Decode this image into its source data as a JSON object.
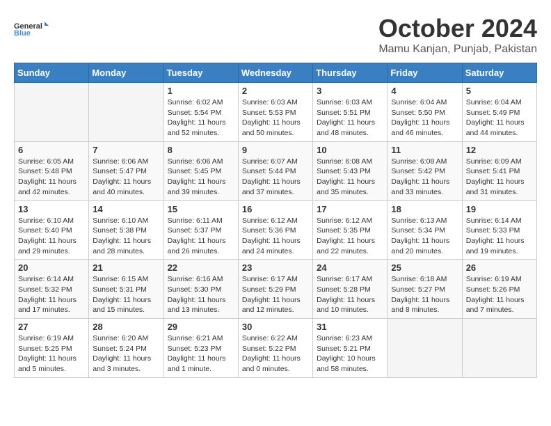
{
  "header": {
    "logo_general": "General",
    "logo_blue": "Blue",
    "month": "October 2024",
    "location": "Mamu Kanjan, Punjab, Pakistan"
  },
  "days_of_week": [
    "Sunday",
    "Monday",
    "Tuesday",
    "Wednesday",
    "Thursday",
    "Friday",
    "Saturday"
  ],
  "weeks": [
    [
      {
        "day": "",
        "empty": true
      },
      {
        "day": "",
        "empty": true
      },
      {
        "day": "1",
        "sunrise": "6:02 AM",
        "sunset": "5:54 PM",
        "daylight": "11 hours and 52 minutes."
      },
      {
        "day": "2",
        "sunrise": "6:03 AM",
        "sunset": "5:53 PM",
        "daylight": "11 hours and 50 minutes."
      },
      {
        "day": "3",
        "sunrise": "6:03 AM",
        "sunset": "5:51 PM",
        "daylight": "11 hours and 48 minutes."
      },
      {
        "day": "4",
        "sunrise": "6:04 AM",
        "sunset": "5:50 PM",
        "daylight": "11 hours and 46 minutes."
      },
      {
        "day": "5",
        "sunrise": "6:04 AM",
        "sunset": "5:49 PM",
        "daylight": "11 hours and 44 minutes."
      }
    ],
    [
      {
        "day": "6",
        "sunrise": "6:05 AM",
        "sunset": "5:48 PM",
        "daylight": "11 hours and 42 minutes."
      },
      {
        "day": "7",
        "sunrise": "6:06 AM",
        "sunset": "5:47 PM",
        "daylight": "11 hours and 40 minutes."
      },
      {
        "day": "8",
        "sunrise": "6:06 AM",
        "sunset": "5:45 PM",
        "daylight": "11 hours and 39 minutes."
      },
      {
        "day": "9",
        "sunrise": "6:07 AM",
        "sunset": "5:44 PM",
        "daylight": "11 hours and 37 minutes."
      },
      {
        "day": "10",
        "sunrise": "6:08 AM",
        "sunset": "5:43 PM",
        "daylight": "11 hours and 35 minutes."
      },
      {
        "day": "11",
        "sunrise": "6:08 AM",
        "sunset": "5:42 PM",
        "daylight": "11 hours and 33 minutes."
      },
      {
        "day": "12",
        "sunrise": "6:09 AM",
        "sunset": "5:41 PM",
        "daylight": "11 hours and 31 minutes."
      }
    ],
    [
      {
        "day": "13",
        "sunrise": "6:10 AM",
        "sunset": "5:40 PM",
        "daylight": "11 hours and 29 minutes."
      },
      {
        "day": "14",
        "sunrise": "6:10 AM",
        "sunset": "5:38 PM",
        "daylight": "11 hours and 28 minutes."
      },
      {
        "day": "15",
        "sunrise": "6:11 AM",
        "sunset": "5:37 PM",
        "daylight": "11 hours and 26 minutes."
      },
      {
        "day": "16",
        "sunrise": "6:12 AM",
        "sunset": "5:36 PM",
        "daylight": "11 hours and 24 minutes."
      },
      {
        "day": "17",
        "sunrise": "6:12 AM",
        "sunset": "5:35 PM",
        "daylight": "11 hours and 22 minutes."
      },
      {
        "day": "18",
        "sunrise": "6:13 AM",
        "sunset": "5:34 PM",
        "daylight": "11 hours and 20 minutes."
      },
      {
        "day": "19",
        "sunrise": "6:14 AM",
        "sunset": "5:33 PM",
        "daylight": "11 hours and 19 minutes."
      }
    ],
    [
      {
        "day": "20",
        "sunrise": "6:14 AM",
        "sunset": "5:32 PM",
        "daylight": "11 hours and 17 minutes."
      },
      {
        "day": "21",
        "sunrise": "6:15 AM",
        "sunset": "5:31 PM",
        "daylight": "11 hours and 15 minutes."
      },
      {
        "day": "22",
        "sunrise": "6:16 AM",
        "sunset": "5:30 PM",
        "daylight": "11 hours and 13 minutes."
      },
      {
        "day": "23",
        "sunrise": "6:17 AM",
        "sunset": "5:29 PM",
        "daylight": "11 hours and 12 minutes."
      },
      {
        "day": "24",
        "sunrise": "6:17 AM",
        "sunset": "5:28 PM",
        "daylight": "11 hours and 10 minutes."
      },
      {
        "day": "25",
        "sunrise": "6:18 AM",
        "sunset": "5:27 PM",
        "daylight": "11 hours and 8 minutes."
      },
      {
        "day": "26",
        "sunrise": "6:19 AM",
        "sunset": "5:26 PM",
        "daylight": "11 hours and 7 minutes."
      }
    ],
    [
      {
        "day": "27",
        "sunrise": "6:19 AM",
        "sunset": "5:25 PM",
        "daylight": "11 hours and 5 minutes."
      },
      {
        "day": "28",
        "sunrise": "6:20 AM",
        "sunset": "5:24 PM",
        "daylight": "11 hours and 3 minutes."
      },
      {
        "day": "29",
        "sunrise": "6:21 AM",
        "sunset": "5:23 PM",
        "daylight": "11 hours and 1 minute."
      },
      {
        "day": "30",
        "sunrise": "6:22 AM",
        "sunset": "5:22 PM",
        "daylight": "11 hours and 0 minutes."
      },
      {
        "day": "31",
        "sunrise": "6:23 AM",
        "sunset": "5:21 PM",
        "daylight": "10 hours and 58 minutes."
      },
      {
        "day": "",
        "empty": true
      },
      {
        "day": "",
        "empty": true
      }
    ]
  ]
}
